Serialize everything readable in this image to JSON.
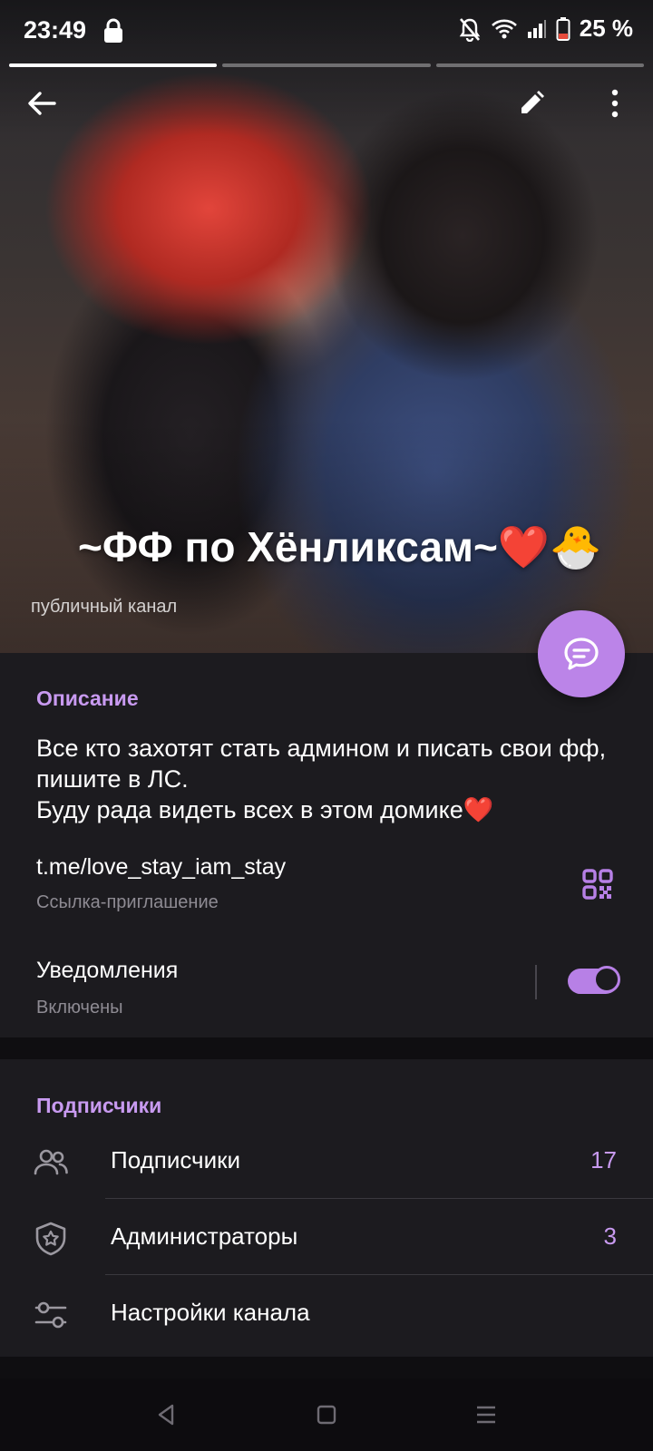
{
  "status_bar": {
    "time": "23:49",
    "battery": "25 %",
    "icons": [
      "lock-icon",
      "mute-bell-icon",
      "wifi-icon",
      "signal-icon",
      "battery-icon"
    ]
  },
  "header": {
    "back_icon": "arrow-left-icon",
    "edit_icon": "pencil-icon",
    "more_icon": "more-vertical-icon",
    "story_segments": [
      {
        "active": true
      },
      {
        "active": false
      },
      {
        "active": false
      }
    ]
  },
  "channel": {
    "title": "~ФФ по Хёнликсам~❤️🐣",
    "type": "публичный канал"
  },
  "info": {
    "description_title": "Описание",
    "description": "Все кто захотят стать админом и писать свои фф, пишите в ЛС.\nБуду рада видеть всех в этом домике❤️",
    "link": "t.me/love_stay_iam_stay",
    "link_caption": "Ссылка-приглашение",
    "notifications_label": "Уведомления",
    "notifications_state": "Включены",
    "notifications_on": true
  },
  "subscribers_section": {
    "title": "Подписчики",
    "rows": [
      {
        "icon": "users-icon",
        "label": "Подписчики",
        "count": "17"
      },
      {
        "icon": "shield-star-icon",
        "label": "Администраторы",
        "count": "3"
      },
      {
        "icon": "sliders-icon",
        "label": "Настройки канала",
        "count": ""
      }
    ]
  },
  "colors": {
    "accent": "#c89af0",
    "fab": "#bb84e8",
    "background": "#1c1b1f",
    "secondary_text": "#8e8b93"
  }
}
